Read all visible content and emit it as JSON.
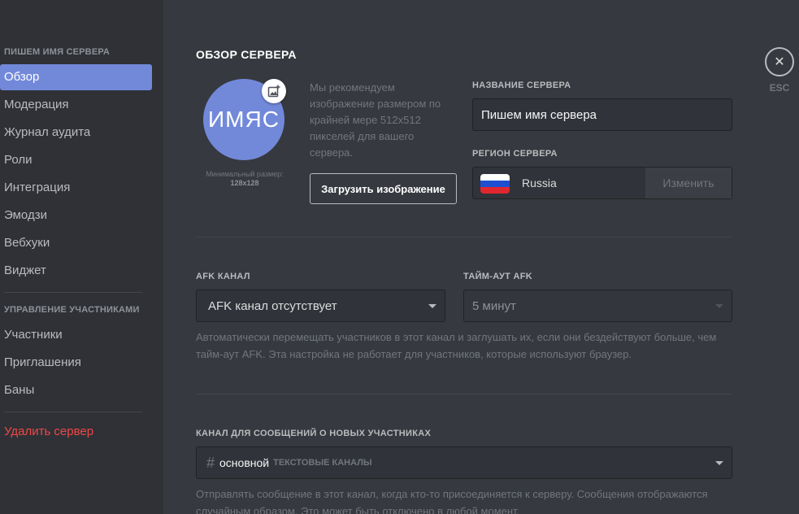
{
  "sidebar": {
    "server_section_title": "ПИШЕМ ИМЯ СЕРВЕРА",
    "server_items": [
      "Обзор",
      "Модерация",
      "Журнал аудита",
      "Роли",
      "Интеграция",
      "Эмодзи",
      "Вебхуки",
      "Виджет"
    ],
    "members_section_title": "УПРАВЛЕНИЕ УЧАСТНИКАМИ",
    "member_items": [
      "Участники",
      "Приглашения",
      "Баны"
    ],
    "delete_label": "Удалить сервер"
  },
  "overview": {
    "title": "ОБЗОР СЕРВЕРА",
    "avatar_text": "ИМЯС",
    "min_size_label": "Минимальный размер:",
    "min_size_value": "128x128",
    "recommend_text": "Мы рекомендуем изображение размером по крайней мере 512x512 пикселей для вашего сервера.",
    "upload_label": "Загрузить изображение",
    "server_name_label": "НАЗВАНИЕ СЕРВЕРА",
    "server_name_value": "Пишем имя сервера",
    "region_label": "РЕГИОН СЕРВЕРА",
    "region_value": "Russia",
    "change_label": "Изменить"
  },
  "afk": {
    "channel_label": "AFK КАНАЛ",
    "channel_value": "AFK канал отсутствует",
    "timeout_label": "ТАЙМ-АУТ AFK",
    "timeout_value": "5 минут",
    "description": "Автоматически перемещать участников в этот канал и заглушать их, если они бездействуют больше, чем тайм-аут AFK. Эта настройка не работает для участников, которые используют браузер."
  },
  "welcome": {
    "label": "КАНАЛ ДЛЯ СООБЩЕНИЙ О НОВЫХ УЧАСТНИКАХ",
    "channel_name": "основной",
    "channel_category": "ТЕКСТОВЫЕ КАНАЛЫ",
    "description": "Отправлять сообщение в этот канал, когда кто-то присоединяется к серверу. Сообщения отображаются случайным образом. Это может быть отключено в любой момент."
  },
  "close": {
    "icon": "close-icon",
    "esc_label": "ESC"
  },
  "colors": {
    "accent": "#7289da",
    "danger": "#f04747",
    "background": "#36393f",
    "sidebar": "#2f3136"
  }
}
